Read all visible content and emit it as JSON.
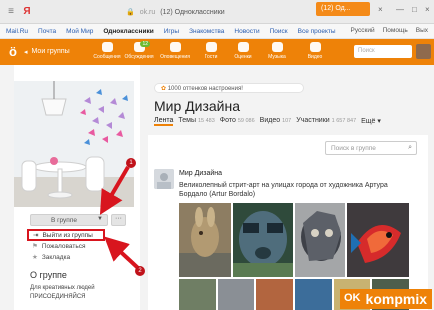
{
  "browser": {
    "address_label": "ok.ru",
    "page_title": "(12) Одноклассники",
    "tab_title": "(12) Од..."
  },
  "bookmarks": {
    "items": [
      "Mail.Ru",
      "Почта",
      "Мой Мир",
      "Одноклассники",
      "Игры",
      "Знакомства",
      "Новости",
      "Поиск",
      "Все проекты"
    ],
    "language": "Русский",
    "help": "Помощь",
    "logout": "Вых"
  },
  "top_nav": {
    "my_groups": "Мои группы",
    "items": [
      {
        "label": "Сообщения",
        "icon": "messages-icon"
      },
      {
        "label": "Обсуждения",
        "icon": "discussions-icon",
        "badge": "12"
      },
      {
        "label": "Оповещения",
        "icon": "notifications-icon"
      },
      {
        "label": "Гости",
        "icon": "guests-icon"
      },
      {
        "label": "Оценки",
        "icon": "ratings-icon"
      },
      {
        "label": "Музыка",
        "icon": "music-icon"
      },
      {
        "label": "Видео",
        "icon": "video-icon"
      }
    ],
    "search_placeholder": "Поиск"
  },
  "group": {
    "hint": "1000 оттенков настроения!",
    "title": "Мир Дизайна",
    "tabs": [
      {
        "label": "Лента",
        "count": ""
      },
      {
        "label": "Темы",
        "count": "15 483"
      },
      {
        "label": "Фото",
        "count": "59 086"
      },
      {
        "label": "Видео",
        "count": "107"
      },
      {
        "label": "Участники",
        "count": "1 657 847"
      },
      {
        "label": "Ещё ▾",
        "count": ""
      }
    ],
    "search_placeholder": "Поиск в группе"
  },
  "left_panel": {
    "in_group_label": "В группе",
    "more_label": "···",
    "menu": {
      "leave": "Выйти из группы",
      "complain": "Пожаловаться",
      "bookmark": "Закладка"
    },
    "about_title": "О группе",
    "about_line1": "Для креативных людей",
    "about_line2": "ПРИСОЕДИНЯЙСЯ"
  },
  "post": {
    "author": "Мир Дизайна",
    "text": "Великолепный стрит-арт на улицах города от художника Артура Бордало (Artur Bordalo)"
  },
  "annotations": {
    "step1": "1",
    "step2": "2",
    "arrow_color": "#d8151e"
  },
  "watermark": {
    "text": "kompmix",
    "ok": "OK"
  },
  "colors": {
    "ok_orange": "#ee8208",
    "link_blue": "#2a5db0",
    "highlight_red": "#d8151e"
  }
}
